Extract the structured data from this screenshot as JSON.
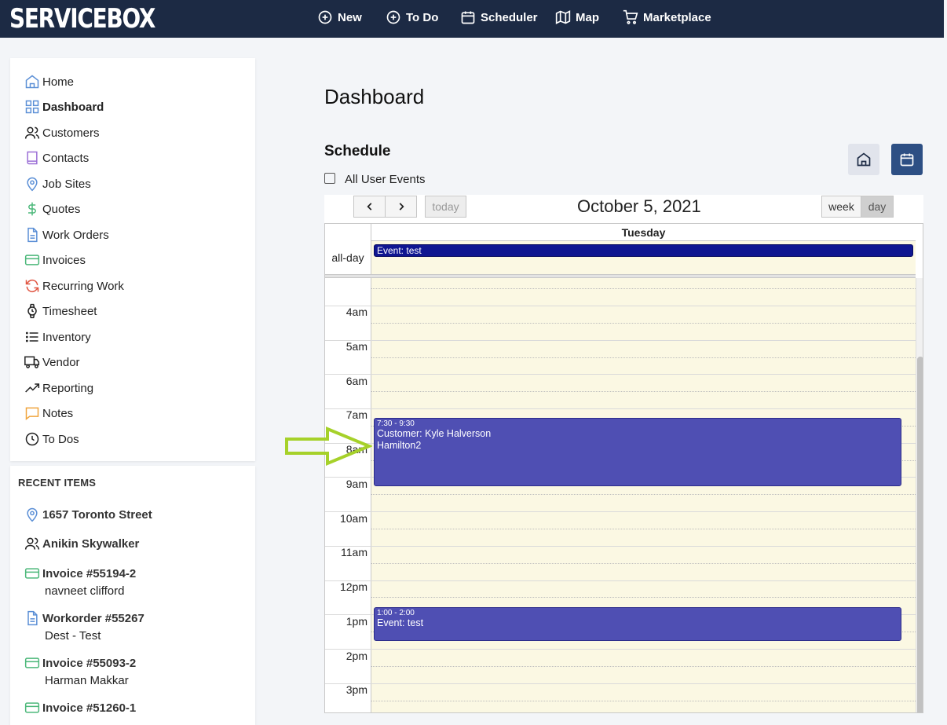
{
  "app": {
    "logo": "SERVICEBOX"
  },
  "nav": [
    {
      "label": "New",
      "icon": "plus-circle-icon"
    },
    {
      "label": "To Do",
      "icon": "plus-circle-icon"
    },
    {
      "label": "Scheduler",
      "icon": "calendar-icon"
    },
    {
      "label": "Map",
      "icon": "map-icon"
    },
    {
      "label": "Marketplace",
      "icon": "cart-icon"
    }
  ],
  "sidebar": {
    "items": [
      {
        "label": "Home",
        "icon": "home-icon"
      },
      {
        "label": "Dashboard",
        "icon": "grid-icon",
        "active": true
      },
      {
        "label": "Customers",
        "icon": "users-icon"
      },
      {
        "label": "Contacts",
        "icon": "book-icon"
      },
      {
        "label": "Job Sites",
        "icon": "map-pin-icon"
      },
      {
        "label": "Quotes",
        "icon": "dollar-icon"
      },
      {
        "label": "Work Orders",
        "icon": "file-text-icon"
      },
      {
        "label": "Invoices",
        "icon": "credit-card-icon"
      },
      {
        "label": "Recurring Work",
        "icon": "refresh-icon"
      },
      {
        "label": "Timesheet",
        "icon": "watch-icon"
      },
      {
        "label": "Inventory",
        "icon": "list-icon"
      },
      {
        "label": "Vendor",
        "icon": "truck-icon"
      },
      {
        "label": "Reporting",
        "icon": "trending-up-icon"
      },
      {
        "label": "Notes",
        "icon": "message-square-icon"
      },
      {
        "label": "To Dos",
        "icon": "clock-icon"
      }
    ]
  },
  "recent": {
    "title": "RECENT ITEMS",
    "items": [
      {
        "title": "1657 Toronto Street",
        "sub": "",
        "icon": "map-pin-icon"
      },
      {
        "title": "Anikin Skywalker",
        "sub": "",
        "icon": "users-icon"
      },
      {
        "title": "Invoice #55194-2",
        "sub": "navneet clifford",
        "icon": "credit-card-icon"
      },
      {
        "title": "Workorder #55267",
        "sub": "Dest - Test",
        "icon": "file-text-icon"
      },
      {
        "title": "Invoice #55093-2",
        "sub": "Harman Makkar",
        "icon": "credit-card-icon"
      },
      {
        "title": "Invoice #51260-1",
        "sub": "",
        "icon": "credit-card-icon"
      }
    ]
  },
  "main": {
    "title": "Dashboard",
    "schedule_title": "Schedule",
    "all_user_events": "All User Events",
    "all_user_events_checked": false
  },
  "calendar": {
    "date_title": "October 5, 2021",
    "prev_label": "‹",
    "next_label": "›",
    "today_label": "today",
    "week_label": "week",
    "day_label": "day",
    "active_view": "day",
    "day_header": "Tuesday",
    "allday_label": "all-day",
    "allday_event": "Event: test",
    "time_labels": [
      "4am",
      "5am",
      "6am",
      "7am",
      "8am",
      "9am",
      "10am",
      "11am",
      "12pm",
      "1pm",
      "2pm",
      "3pm"
    ],
    "events": [
      {
        "time": "7:30 - 9:30",
        "lines": [
          "Customer: Kyle Halverson",
          "Hamilton2"
        ],
        "start": 7.5,
        "end": 9.5
      },
      {
        "time": "1:00 - 2:00",
        "lines": [
          "Event: test"
        ],
        "start": 13,
        "end": 14
      }
    ],
    "event_color": "#4f4fb3",
    "allday_event_color": "#0f1691",
    "grid_bg": "#fbf8e3"
  },
  "annotation": {
    "arrow_color": "#a6d12a"
  }
}
